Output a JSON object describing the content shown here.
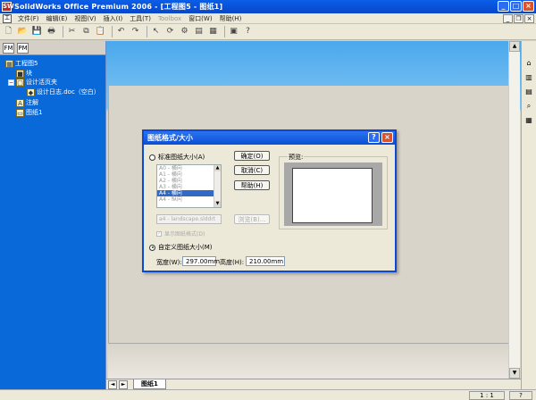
{
  "window": {
    "title": "SolidWorks Office Premium 2006 - [工程图5 - 图纸1]",
    "app_icon": "SW",
    "controls": [
      "_",
      "□",
      "×"
    ]
  },
  "menu": {
    "doc_icon": "工",
    "items": [
      "文件(F)",
      "编辑(E)",
      "视图(V)",
      "插入(I)",
      "工具(T)",
      "Toolbox",
      "窗口(W)",
      "帮助(H)"
    ],
    "mdi_controls": [
      "_",
      "❐",
      "×"
    ]
  },
  "toolbar": {
    "icons": [
      "new-icon",
      "open-icon",
      "save-icon",
      "print-icon",
      "cut-icon",
      "copy-icon",
      "paste-icon",
      "undo-icon",
      "redo-icon",
      "select-icon",
      "rebuild-icon",
      "options-icon",
      "help-icon"
    ]
  },
  "tree": {
    "tabs": [
      "FM",
      "PM"
    ],
    "root": "工程图5",
    "items": [
      {
        "label": "块",
        "icon": "■"
      },
      {
        "label": "设计活页夹",
        "icon": "□",
        "toggle": "−"
      },
      {
        "label": "设计日志.doc（空白）",
        "icon": "◆"
      },
      {
        "label": "注解",
        "icon": "A"
      },
      {
        "label": "图纸1",
        "icon": "▭"
      }
    ]
  },
  "sheet_tabs": {
    "nav": [
      "◄",
      "►"
    ],
    "active": "图纸1"
  },
  "status": {
    "scale": "1 : 1",
    "help": "?"
  },
  "dialog": {
    "title": "图纸格式/大小",
    "radio_standard": "标准图纸大小(A)",
    "radio_custom": "自定义图纸大小(M)",
    "sizes": [
      "A0 - 横向",
      "A1 - 横向",
      "A2 - 横向",
      "A3 - 横向",
      "A4 - 横向",
      "A4 - 纵向"
    ],
    "selected_index": 4,
    "format_file": "a4 - landscape.slddrt",
    "browse": "浏览(B)...",
    "show_format": "显示图纸格式(D)",
    "ok": "确定(O)",
    "cancel": "取消(C)",
    "help": "帮助(H)",
    "preview_label": "预览:",
    "width_label": "宽度(W):",
    "width_value": "297.00mm",
    "height_label": "高度(H):",
    "height_value": "210.00mm"
  }
}
